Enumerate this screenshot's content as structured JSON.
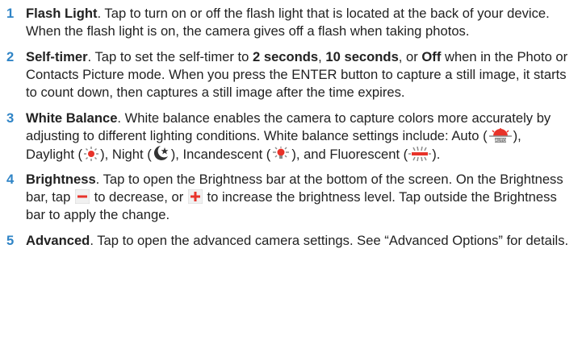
{
  "items": [
    {
      "number": "1",
      "term": "Flash Light",
      "text": ". Tap to turn on or off the flash light that is located at the back of your device. When the flash light is on, the camera gives off a flash when taking photos."
    },
    {
      "number": "2",
      "term": "Self-timer",
      "text_a": ". Tap to set the self-timer to ",
      "opt1": "2 seconds",
      "text_b": ", ",
      "opt2": "10 seconds",
      "text_c": ", or ",
      "opt3": "Off",
      "text_d": " when in the Photo or Contacts Picture mode. When you press the ENTER button to capture a still image, it starts to count down, then captures a still image after the time expires."
    },
    {
      "number": "3",
      "term": "White Balance",
      "text_a": ". White balance enables the camera to capture colors more accurately by adjusting to different lighting conditions. White balance settings include: Auto (",
      "text_b": "), Daylight (",
      "text_c": "), Night (",
      "text_d": "), Incandescent (",
      "text_e": "), and Fluorescent (",
      "text_f": ").",
      "icons": [
        "auto-white-balance-icon",
        "daylight-icon",
        "night-icon",
        "incandescent-icon",
        "fluorescent-icon"
      ]
    },
    {
      "number": "4",
      "term": "Brightness",
      "text_a": ". Tap to open the Brightness bar at the bottom of the screen. On the Brightness bar, tap ",
      "text_b": " to decrease, or ",
      "text_c": " to increase the brightness level. Tap outside the Brightness bar to apply the change.",
      "icons": [
        "minus-icon",
        "plus-icon"
      ]
    },
    {
      "number": "5",
      "term": "Advanced",
      "text": ". Tap to open the advanced camera settings. See “Advanced Options” for details."
    }
  ],
  "colors": {
    "number": "#2f84c6",
    "text": "#222222",
    "icon_red": "#e8332a",
    "icon_gray": "#8a8a8a"
  }
}
